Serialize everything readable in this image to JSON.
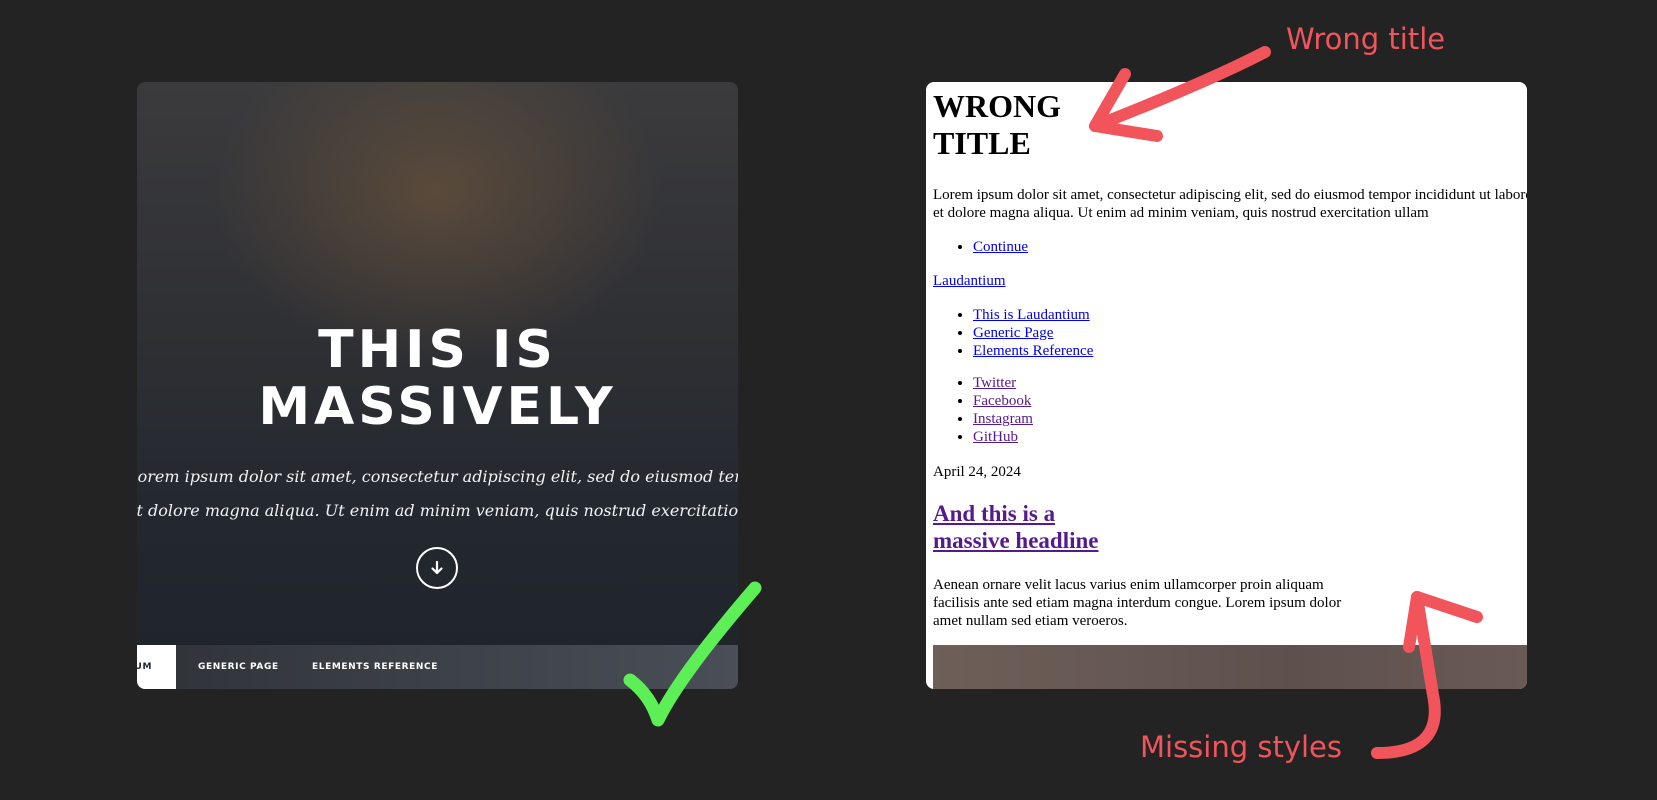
{
  "left_page": {
    "title_lines": [
      "THIS IS",
      "MASSIVELY"
    ],
    "lead_lines": [
      "Lorem ipsum dolor sit amet, consectetur adipiscing elit, sed do eiusmod tempor incididunt ut labore",
      "et dolore magna aliqua. Ut enim ad minim veniam, quis nostrud exercitation ullam"
    ],
    "nav": {
      "active_label": "LAUDANTIUM",
      "items": [
        "GENERIC PAGE",
        "ELEMENTS REFERENCE"
      ]
    }
  },
  "right_page": {
    "title_lines": [
      "WRONG",
      "TITLE"
    ],
    "lead_lines": [
      "Lorem ipsum dolor sit amet, consectetur adipiscing elit, sed do eiusmod tempor incididunt ut labore",
      "et dolore magna aliqua. Ut enim ad minim veniam, quis nostrud exercitation ullam"
    ],
    "continue_link": "Continue",
    "logo_link": "Laudantium",
    "nav_links": [
      "This is Laudantium",
      "Generic Page",
      "Elements Reference"
    ],
    "social_links": [
      "Twitter",
      "Facebook",
      "Instagram",
      "GitHub"
    ],
    "date": "April 24, 2024",
    "headline_lines": [
      "And this is a",
      "massive headline"
    ],
    "body_lines": [
      "Aenean ornare velit lacus varius enim ullamcorper proin aliquam",
      "facilisis ante sed etiam magna interdum congue. Lorem ipsum dolor",
      "amet nullam sed etiam veroeros."
    ]
  },
  "annotations": {
    "top": "Wrong title",
    "bottom": "Missing styles"
  },
  "colors": {
    "background": "#232323",
    "annotation": "#f2545b",
    "check": "#5df056",
    "link": "#0000ee",
    "visited_link": "#551a8b"
  },
  "icons": {
    "scroll_down": "arrow-down-circle-icon",
    "check": "checkmark-icon"
  }
}
